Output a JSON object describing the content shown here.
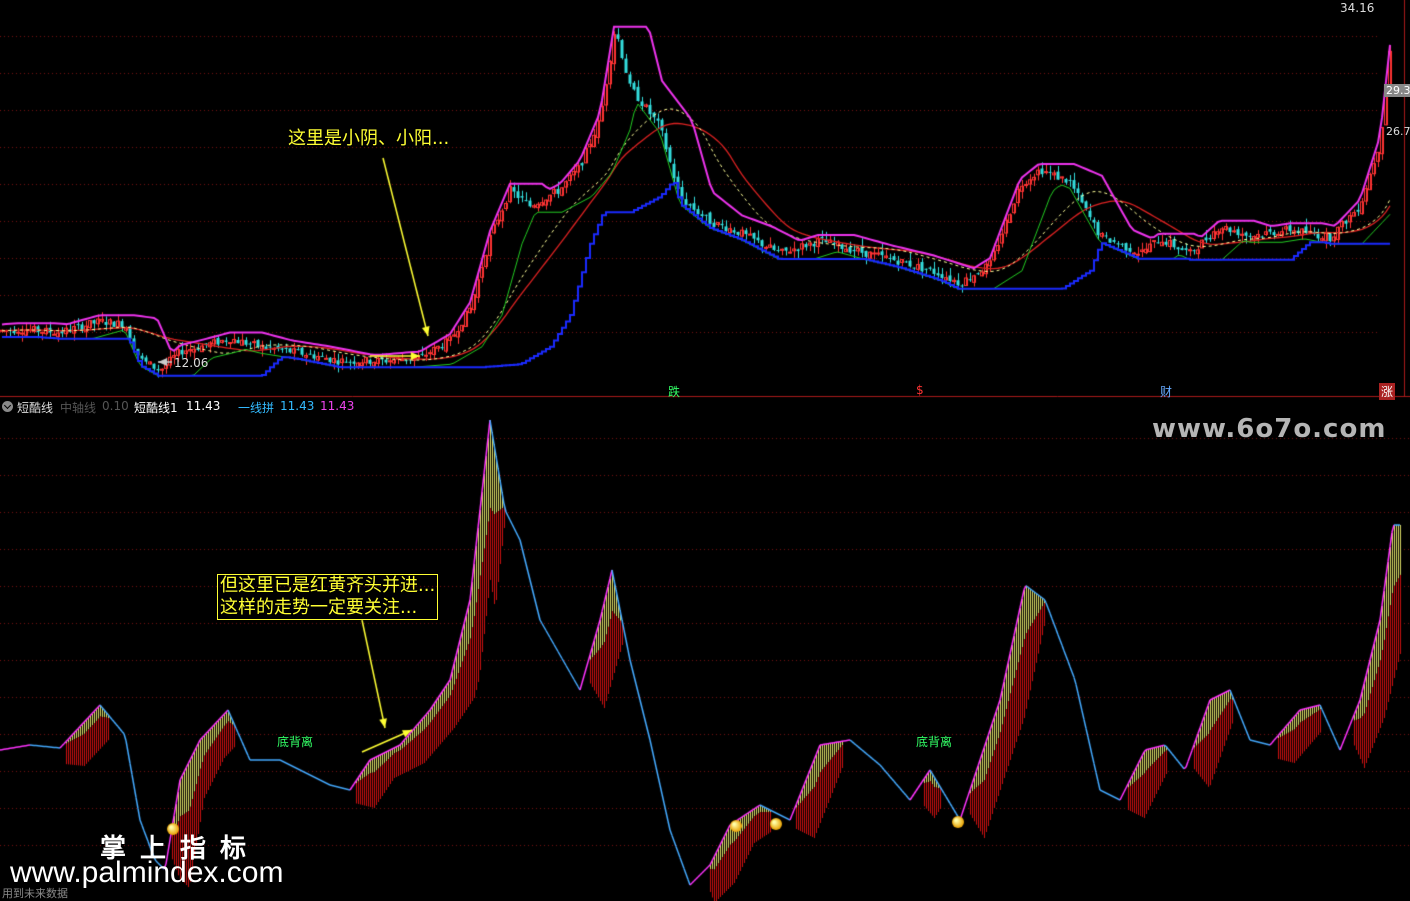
{
  "chart_data": [
    {
      "type": "candlestick",
      "panel": "main",
      "price_labels": {
        "high": "34.16",
        "low": "12.06",
        "right_mid": "29.3",
        "right_low": "26.7"
      },
      "annotation": "这里是小阴、小阳...",
      "markers": [
        {
          "label": "跌",
          "color": "#33ff66"
        },
        {
          "label": "$",
          "color": "#ff3333"
        },
        {
          "label": "财",
          "color": "#66aaff"
        },
        {
          "label": "涨",
          "color": "#ffffff"
        }
      ],
      "price_path": [
        [
          0,
          14.6
        ],
        [
          20,
          14.7
        ],
        [
          60,
          14.5
        ],
        [
          100,
          15.2
        ],
        [
          125,
          15.0
        ],
        [
          140,
          12.8
        ],
        [
          160,
          12.1
        ],
        [
          180,
          13.3
        ],
        [
          200,
          13.6
        ],
        [
          230,
          14.1
        ],
        [
          260,
          13.6
        ],
        [
          300,
          13.2
        ],
        [
          340,
          12.7
        ],
        [
          380,
          12.7
        ],
        [
          420,
          12.9
        ],
        [
          450,
          14.0
        ],
        [
          470,
          16.0
        ],
        [
          490,
          20.5
        ],
        [
          510,
          23.5
        ],
        [
          530,
          22.5
        ],
        [
          560,
          23.5
        ],
        [
          580,
          25.0
        ],
        [
          600,
          28.0
        ],
        [
          615,
          33.8
        ],
        [
          630,
          30.0
        ],
        [
          660,
          27.5
        ],
        [
          680,
          23.0
        ],
        [
          710,
          21.5
        ],
        [
          740,
          20.8
        ],
        [
          780,
          19.5
        ],
        [
          820,
          20.3
        ],
        [
          860,
          19.6
        ],
        [
          900,
          19.0
        ],
        [
          940,
          18.2
        ],
        [
          960,
          17.6
        ],
        [
          990,
          18.8
        ],
        [
          1020,
          23.8
        ],
        [
          1040,
          24.8
        ],
        [
          1070,
          24.0
        ],
        [
          1100,
          20.6
        ],
        [
          1140,
          19.5
        ],
        [
          1160,
          20.4
        ],
        [
          1190,
          19.5
        ],
        [
          1220,
          21.2
        ],
        [
          1250,
          20.6
        ],
        [
          1290,
          21.0
        ],
        [
          1330,
          20.5
        ],
        [
          1360,
          22.5
        ],
        [
          1380,
          26.5
        ],
        [
          1393,
          34.0
        ]
      ],
      "ylim": [
        11.5,
        35.0
      ]
    },
    {
      "type": "bar",
      "panel": "indicator",
      "title": "短酷线",
      "legend": [
        {
          "name": "中轴线",
          "value": "0.10",
          "color": "#666666"
        },
        {
          "name": "短酷线1",
          "value": "11.43",
          "color": "#ffffff"
        },
        {
          "name": "一线拼",
          "value": "11.43",
          "value2": "11.43",
          "color": "#33bbff"
        }
      ],
      "annotation": [
        "但这里已是红黄齐头并进...",
        "这样的走势一定要关注..."
      ],
      "labels": [
        "底背离",
        "底背离"
      ],
      "line_path": [
        [
          0,
          750
        ],
        [
          30,
          745
        ],
        [
          60,
          748
        ],
        [
          100,
          705
        ],
        [
          125,
          735
        ],
        [
          140,
          820
        ],
        [
          155,
          860
        ],
        [
          165,
          870
        ],
        [
          180,
          780
        ],
        [
          200,
          740
        ],
        [
          228,
          710
        ],
        [
          250,
          760
        ],
        [
          280,
          760
        ],
        [
          300,
          770
        ],
        [
          330,
          785
        ],
        [
          350,
          790
        ],
        [
          370,
          760
        ],
        [
          400,
          745
        ],
        [
          430,
          710
        ],
        [
          450,
          680
        ],
        [
          470,
          600
        ],
        [
          490,
          420
        ],
        [
          505,
          510
        ],
        [
          520,
          540
        ],
        [
          540,
          620
        ],
        [
          560,
          655
        ],
        [
          580,
          690
        ],
        [
          600,
          620
        ],
        [
          612,
          570
        ],
        [
          630,
          660
        ],
        [
          650,
          740
        ],
        [
          670,
          830
        ],
        [
          690,
          885
        ],
        [
          710,
          865
        ],
        [
          730,
          825
        ],
        [
          760,
          805
        ],
        [
          790,
          820
        ],
        [
          820,
          745
        ],
        [
          850,
          740
        ],
        [
          880,
          765
        ],
        [
          910,
          800
        ],
        [
          930,
          770
        ],
        [
          960,
          820
        ],
        [
          980,
          760
        ],
        [
          1000,
          700
        ],
        [
          1025,
          585
        ],
        [
          1045,
          600
        ],
        [
          1075,
          680
        ],
        [
          1100,
          790
        ],
        [
          1120,
          800
        ],
        [
          1145,
          750
        ],
        [
          1165,
          745
        ],
        [
          1185,
          770
        ],
        [
          1210,
          700
        ],
        [
          1230,
          690
        ],
        [
          1250,
          740
        ],
        [
          1270,
          745
        ],
        [
          1300,
          710
        ],
        [
          1320,
          705
        ],
        [
          1340,
          750
        ],
        [
          1360,
          700
        ],
        [
          1380,
          620
        ],
        [
          1393,
          525
        ],
        [
          1400,
          525
        ]
      ]
    }
  ],
  "watermarks": {
    "right": "www.6o7o.com",
    "cn": "掌上指标",
    "url": "www.palmindex.com"
  },
  "footer": "用到未来数据"
}
